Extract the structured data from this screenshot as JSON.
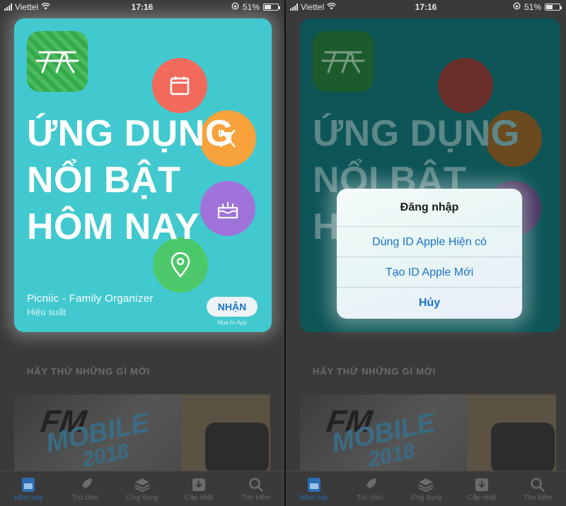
{
  "status_bar": {
    "carrier": "Viettel",
    "time": "17:16",
    "battery": "51%",
    "battery_fill": 0.51
  },
  "feature": {
    "headline_1": "ỨNG DỤNG",
    "headline_2": "NỔI BẬT",
    "headline_3": "HÔM NAY",
    "app_name": "Picniic - Family Organizer",
    "app_subtitle": "Hiệu suất",
    "get_label": "NHẬN",
    "iap_note": "Mua In-App",
    "colors": {
      "card": "#41c9cf",
      "app_icon": "#37b24d",
      "get_text": "#1a73c9"
    }
  },
  "section_title": "HÃY THỬ NHỮNG GÌ MỚI",
  "promo": {
    "title_1": "FM",
    "title_2": "MOBILE",
    "title_3": "2018"
  },
  "tabs": [
    {
      "label": "Hôm nay",
      "icon": "today-icon"
    },
    {
      "label": "Trò chơi",
      "icon": "rocket-icon"
    },
    {
      "label": "Ứng dụng",
      "icon": "stack-icon"
    },
    {
      "label": "Cập nhật",
      "icon": "download-icon"
    },
    {
      "label": "Tìm kiếm",
      "icon": "search-icon"
    }
  ],
  "alert": {
    "title": "Đăng nhập",
    "option_existing": "Dùng ID Apple Hiện có",
    "option_new": "Tạo ID Apple Mới",
    "cancel": "Hủy"
  }
}
